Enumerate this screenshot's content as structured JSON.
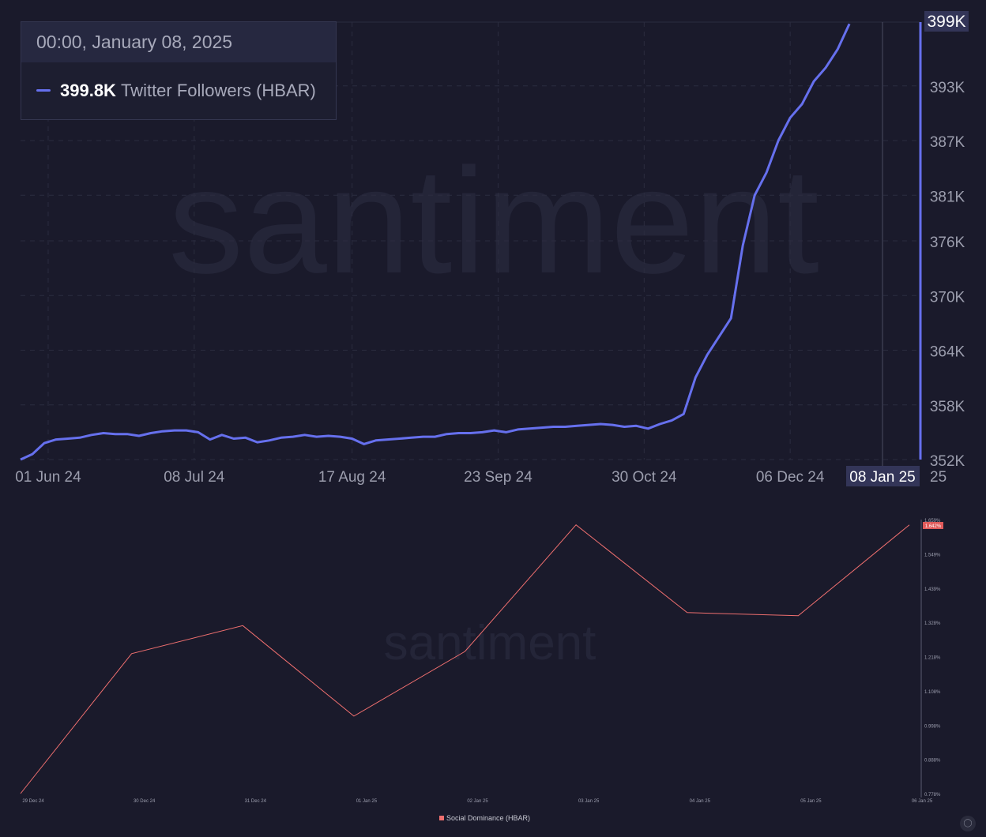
{
  "watermark": "santiment",
  "colors": {
    "background": "#1a1a2b",
    "followers_line": "#6670ee",
    "dominance_line": "#ef6f6f",
    "grid": "#2b2c3f",
    "axis_text": "#9c9eae",
    "watermark": "#242538",
    "highlight_box": "#333558"
  },
  "tooltip": {
    "timestamp": "00:00, January 08, 2025",
    "value": "399.8K",
    "label": "Twitter Followers (HBAR)"
  },
  "legend": {
    "label": "Social Dominance (HBAR)",
    "icon": "social-dominance-swatch"
  },
  "corner_icon": "santiment-logo-icon",
  "chart_data": [
    {
      "type": "line",
      "series": [
        {
          "name": "Twitter Followers (HBAR)",
          "color": "#6670ee"
        }
      ],
      "x": [
        "2024-05-25",
        "2024-05-28",
        "2024-05-31",
        "2024-06-03",
        "2024-06-06",
        "2024-06-09",
        "2024-06-12",
        "2024-06-15",
        "2024-06-18",
        "2024-06-21",
        "2024-06-24",
        "2024-06-27",
        "2024-06-30",
        "2024-07-03",
        "2024-07-06",
        "2024-07-09",
        "2024-07-12",
        "2024-07-15",
        "2024-07-18",
        "2024-07-21",
        "2024-07-24",
        "2024-07-27",
        "2024-07-30",
        "2024-08-02",
        "2024-08-05",
        "2024-08-08",
        "2024-08-11",
        "2024-08-14",
        "2024-08-17",
        "2024-08-20",
        "2024-08-23",
        "2024-08-26",
        "2024-08-29",
        "2024-09-01",
        "2024-09-04",
        "2024-09-07",
        "2024-09-10",
        "2024-09-13",
        "2024-09-16",
        "2024-09-19",
        "2024-09-22",
        "2024-09-25",
        "2024-09-28",
        "2024-10-01",
        "2024-10-04",
        "2024-10-07",
        "2024-10-10",
        "2024-10-13",
        "2024-10-16",
        "2024-10-19",
        "2024-10-22",
        "2024-10-25",
        "2024-10-28",
        "2024-10-31",
        "2024-11-03",
        "2024-11-06",
        "2024-11-09",
        "2024-11-12",
        "2024-11-15",
        "2024-11-18",
        "2024-11-21",
        "2024-11-24",
        "2024-11-27",
        "2024-11-30",
        "2024-12-03",
        "2024-12-06",
        "2024-12-09",
        "2024-12-12",
        "2024-12-15",
        "2024-12-18",
        "2024-12-21",
        "2024-12-24",
        "2024-12-27",
        "2024-12-30",
        "2025-01-02",
        "2025-01-05",
        "2025-01-08"
      ],
      "values": [
        352000,
        352600,
        353800,
        354200,
        354300,
        354400,
        354700,
        354900,
        354800,
        354800,
        354600,
        354900,
        355100,
        355200,
        355200,
        355000,
        354200,
        354700,
        354300,
        354400,
        353900,
        354100,
        354400,
        354500,
        354700,
        354500,
        354600,
        354500,
        354300,
        353700,
        354100,
        354200,
        354300,
        354400,
        354500,
        354500,
        354800,
        354900,
        354900,
        355000,
        355200,
        355000,
        355300,
        355400,
        355500,
        355600,
        355600,
        355700,
        355800,
        355900,
        355800,
        355600,
        355700,
        355400,
        355900,
        356300,
        357000,
        361000,
        363500,
        365500,
        367500,
        375500,
        381000,
        383500,
        387000,
        389500,
        391000,
        393500,
        395000,
        397000,
        399800
      ],
      "ylim": [
        352000,
        400000
      ],
      "xlim": [
        "2024-05-25",
        "2025-01-08"
      ],
      "y_ticks": [
        "352K",
        "358K",
        "364K",
        "370K",
        "376K",
        "381K",
        "387K",
        "393K",
        "399K"
      ],
      "x_ticks": [
        "01 Jun 24",
        "08 Jul 24",
        "17 Aug 24",
        "23 Sep 24",
        "30 Oct 24",
        "06 Dec 24",
        "08 Jan 25"
      ],
      "highlight_y": "399K",
      "highlight_x": "08 Jan 25",
      "clipped_label": "25",
      "grid": true
    },
    {
      "type": "line",
      "series": [
        {
          "name": "Social Dominance (HBAR)",
          "color": "#ef6f6f"
        }
      ],
      "categories": [
        "29 Dec 24",
        "30 Dec 24",
        "31 Dec 24",
        "01 Jan 25",
        "02 Jan 25",
        "03 Jan 25",
        "04 Jan 25",
        "05 Jan 25",
        "06 Jan 25"
      ],
      "values": [
        0.778,
        1.228,
        1.318,
        1.027,
        1.235,
        1.642,
        1.36,
        1.35,
        1.642
      ],
      "ylim": [
        0.778,
        1.659
      ],
      "y_ticks": [
        "0.778%",
        "0.888%",
        "0.998%",
        "1.108%",
        "1.218%",
        "1.328%",
        "1.439%",
        "1.549%",
        "1.659%"
      ],
      "highlight_y": "1.642%",
      "grid": false,
      "legend_position": "bottom-center"
    }
  ]
}
